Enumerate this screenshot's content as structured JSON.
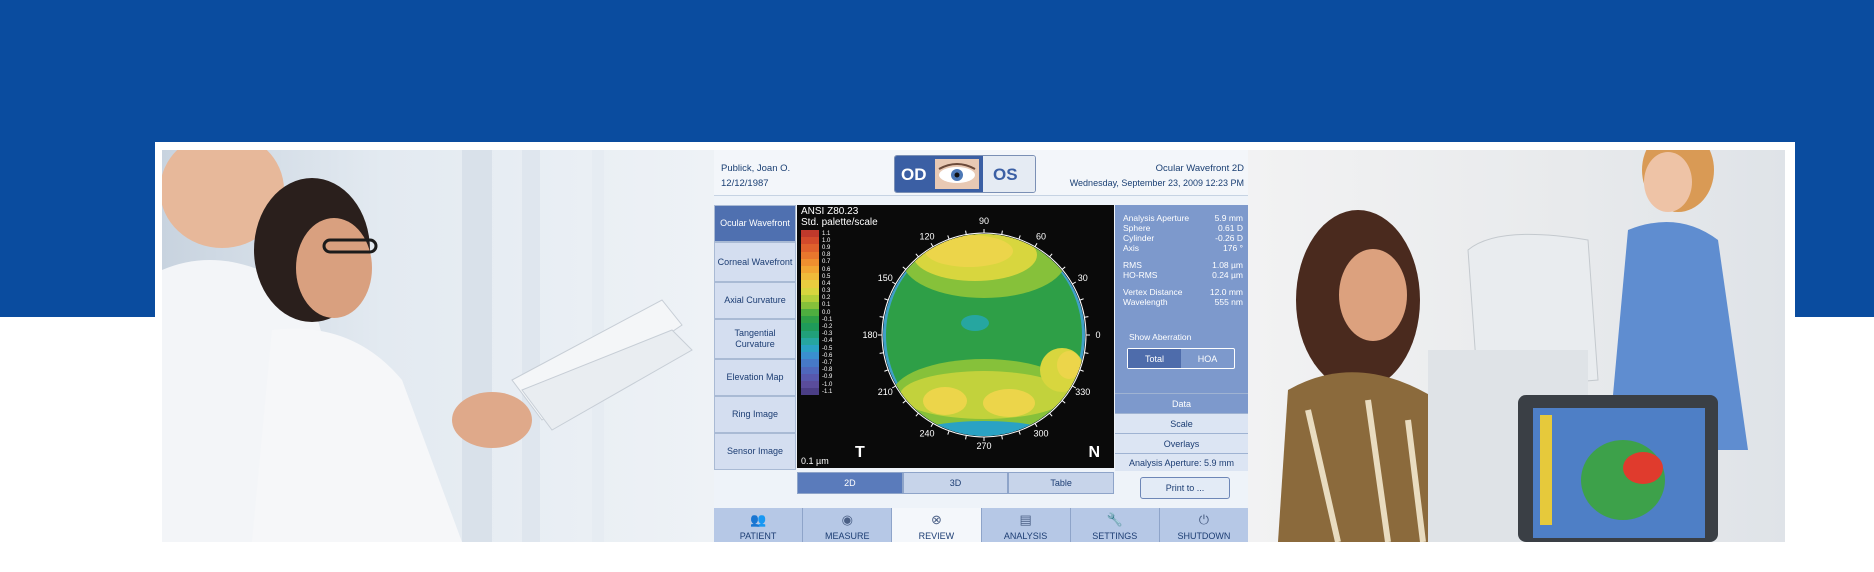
{
  "patient": {
    "name": "Publick, Joan O.",
    "dob": "12/12/1987"
  },
  "eye_selector": {
    "od": "OD",
    "os": "OS"
  },
  "header": {
    "title": "Ocular Wavefront 2D",
    "date": "Wednesday, September 23, 2009 12:23 PM"
  },
  "left_nav": [
    {
      "label": "Ocular Wavefront"
    },
    {
      "label": "Corneal Wavefront"
    },
    {
      "label": "Axial Curvature"
    },
    {
      "label": "Tangential Curvature"
    },
    {
      "label": "Elevation Map"
    },
    {
      "label": "Ring Image"
    },
    {
      "label": "Sensor Image"
    }
  ],
  "map": {
    "standard": "ANSI Z80.23",
    "palette": "Std. palette/scale",
    "unit_label": "0.1 µm",
    "left_letter": "T",
    "right_letter": "N",
    "axis_labels": [
      "0",
      "30",
      "60",
      "90",
      "120",
      "150",
      "180",
      "210",
      "240",
      "270",
      "300",
      "330"
    ],
    "scale": [
      {
        "value": "1.1",
        "color": "#c0392b"
      },
      {
        "value": "1.0",
        "color": "#d34a2b"
      },
      {
        "value": "0.9",
        "color": "#e0602c"
      },
      {
        "value": "0.8",
        "color": "#e8772d"
      },
      {
        "value": "0.7",
        "color": "#ef8f2f"
      },
      {
        "value": "0.6",
        "color": "#f2a633"
      },
      {
        "value": "0.5",
        "color": "#f0bb3a"
      },
      {
        "value": "0.4",
        "color": "#e9cd3f"
      },
      {
        "value": "0.3",
        "color": "#d8d63e"
      },
      {
        "value": "0.2",
        "color": "#b3cf39"
      },
      {
        "value": "0.1",
        "color": "#86c13a"
      },
      {
        "value": "0.0",
        "color": "#4fae3f"
      },
      {
        "value": "-0.1",
        "color": "#2e9f47"
      },
      {
        "value": "-0.2",
        "color": "#1f9a5a"
      },
      {
        "value": "-0.3",
        "color": "#21a07a"
      },
      {
        "value": "-0.4",
        "color": "#26a6a0"
      },
      {
        "value": "-0.5",
        "color": "#2aa2c4"
      },
      {
        "value": "-0.6",
        "color": "#3a8fcf"
      },
      {
        "value": "-0.7",
        "color": "#4679c8"
      },
      {
        "value": "-0.8",
        "color": "#4f67bc"
      },
      {
        "value": "-0.9",
        "color": "#5758ad"
      },
      {
        "value": "-1.0",
        "color": "#5a4c9c"
      },
      {
        "value": "-1.1",
        "color": "#4b3e86"
      }
    ]
  },
  "stats": [
    {
      "label": "Analysis Aperture",
      "value": "5.9 mm"
    },
    {
      "label": "Sphere",
      "value": "0.61 D"
    },
    {
      "label": "Cylinder",
      "value": "-0.26 D"
    },
    {
      "label": "Axis",
      "value": "176 °"
    },
    {
      "label": "RMS",
      "value": "1.08 µm"
    },
    {
      "label": "HO-RMS",
      "value": "0.24 µm"
    },
    {
      "label": "Vertex Distance",
      "value": "12.0 mm"
    },
    {
      "label": "Wavelength",
      "value": "555 nm"
    }
  ],
  "show_aberration": {
    "label": "Show Aberration",
    "options": [
      "Total",
      "HOA"
    ],
    "selected": "Total"
  },
  "right_buttons": [
    "Data",
    "Scale",
    "Overlays",
    "Analysis Aperture: 5.9 mm"
  ],
  "view_tabs": [
    "2D",
    "3D",
    "Table"
  ],
  "print_label": "Print to ...",
  "bottom_nav": [
    {
      "label": "PATIENT"
    },
    {
      "label": "MEASURE"
    },
    {
      "label": "REVIEW"
    },
    {
      "label": "ANALYSIS"
    },
    {
      "label": "SETTINGS"
    },
    {
      "label": "SHUTDOWN"
    }
  ],
  "colors": {
    "brand_blue": "#0a4c9f",
    "panel_accent": "#4f70b0"
  }
}
